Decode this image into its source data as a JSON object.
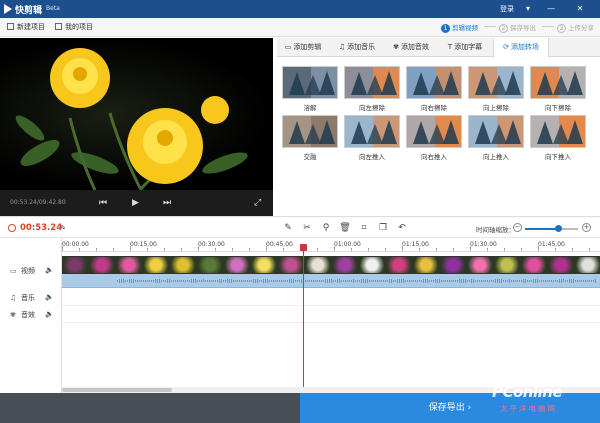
{
  "app": {
    "title": "快剪辑",
    "beta": "Beta",
    "login": "登录"
  },
  "toolbar": {
    "new_project": "新建项目",
    "my_projects": "我的项目"
  },
  "steps": [
    {
      "num": "1",
      "label": "剪辑视频",
      "active": true
    },
    {
      "num": "2",
      "label": "保存导出",
      "active": false
    },
    {
      "num": "3",
      "label": "上传分享",
      "active": false
    }
  ],
  "preview": {
    "time": "00:53.24/09:42.80"
  },
  "tabs": [
    {
      "label": "添加剪辑",
      "icon": "film-icon"
    },
    {
      "label": "添加音乐",
      "icon": "music-icon"
    },
    {
      "label": "添加音效",
      "icon": "effect-icon"
    },
    {
      "label": "添加字幕",
      "icon": "text-icon"
    },
    {
      "label": "添加转场",
      "icon": "transition-icon",
      "active": true
    }
  ],
  "transitions": [
    {
      "label": "溶解"
    },
    {
      "label": "向左擦除"
    },
    {
      "label": "向右擦除"
    },
    {
      "label": "向上擦除"
    },
    {
      "label": "向下擦除"
    },
    {
      "label": "交融"
    },
    {
      "label": "向左推入"
    },
    {
      "label": "向右推入"
    },
    {
      "label": "向上推入"
    },
    {
      "label": "向下推入"
    }
  ],
  "timeline": {
    "current_time": "00:53.24",
    "zoom_label": "时间轴缩放：",
    "zoom_level": 0.62,
    "ticks": [
      "00:00.00",
      "00:15.00",
      "00:30.00",
      "00:45.00",
      "01:00.00",
      "01:15.00",
      "01:30.00",
      "01:45.00"
    ],
    "tracks": [
      {
        "label": "视频",
        "icon": "video-icon"
      },
      {
        "label": "音乐",
        "icon": "music-icon"
      },
      {
        "label": "音效",
        "icon": "effect-icon"
      }
    ]
  },
  "footer": {
    "export": "保存导出 ›"
  },
  "watermark": {
    "main": "PConline",
    "sub": "太平洋电脑网"
  },
  "colors": {
    "accent": "#1a73c9",
    "titlebar": "#1d4f8f",
    "playhead": "#d0314b",
    "time_red": "#e0402a"
  }
}
